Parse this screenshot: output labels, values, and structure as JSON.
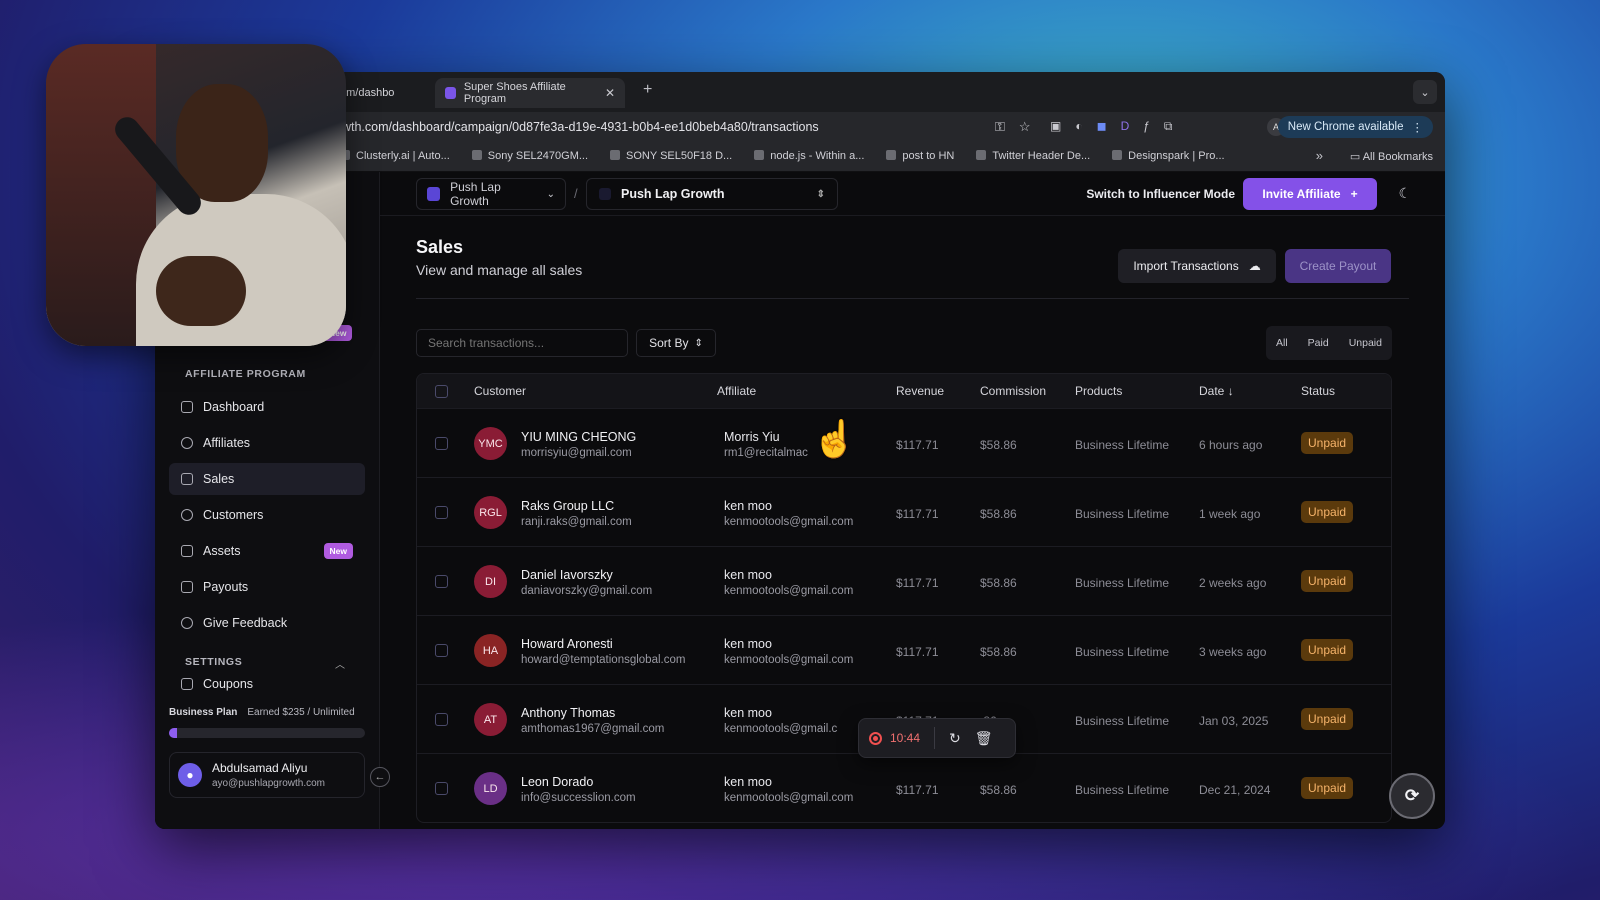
{
  "browser": {
    "tabs": [
      {
        "title": "om/dashbo"
      },
      {
        "title": "Super Shoes Affiliate Program"
      }
    ],
    "url": "owth.com/dashboard/campaign/0d87fe3a-d19e-4931-b0b4-ee1d0beb4a80/transactions",
    "new_chrome_label": "New Chrome available",
    "profile_initial": "A",
    "bookmarks": [
      "Clusterly.ai | Auto...",
      "Sony SEL2470GM...",
      "SONY SEL50F18 D...",
      "node.js - Within a...",
      "post to HN",
      "Twitter Header De...",
      "Designspark | Pro..."
    ],
    "all_bookmarks_label": "All Bookmarks"
  },
  "topbar": {
    "team": "Push Lap Growth",
    "campaign": "Push Lap Growth",
    "switch_mode": "Switch to Influencer Mode",
    "invite_label": "Invite Affiliate"
  },
  "sidebar": {
    "new_badge_top": "New",
    "section_affiliate": "AFFILIATE PROGRAM",
    "items": [
      {
        "label": "Dashboard",
        "active": false,
        "icon": "grid-icon"
      },
      {
        "label": "Affiliates",
        "active": false,
        "icon": "users-icon"
      },
      {
        "label": "Sales",
        "active": true,
        "icon": "receipt-icon"
      },
      {
        "label": "Customers",
        "active": false,
        "icon": "customers-icon"
      },
      {
        "label": "Assets",
        "active": false,
        "icon": "folder-icon",
        "badge": "New"
      },
      {
        "label": "Payouts",
        "active": false,
        "icon": "bank-icon"
      },
      {
        "label": "Give Feedback",
        "active": false,
        "icon": "info-icon"
      }
    ],
    "section_settings": "SETTINGS",
    "settings_partial_item": "Coupons",
    "plan_name": "Business Plan",
    "plan_usage": "Earned $235 / Unlimited",
    "plan_progress": 0.04,
    "user_name": "Abdulsamad Aliyu",
    "user_email": "ayo@pushlapgrowth.com"
  },
  "page": {
    "title": "Sales",
    "subtitle": "View and manage all sales",
    "import_label": "Import Transactions",
    "payout_label": "Create Payout",
    "search_placeholder": "Search transactions...",
    "sort_label": "Sort By",
    "filters": [
      "All",
      "Paid",
      "Unpaid"
    ]
  },
  "table": {
    "headers": {
      "customer": "Customer",
      "affiliate": "Affiliate",
      "revenue": "Revenue",
      "commission": "Commission",
      "products": "Products",
      "date": "Date",
      "status": "Status"
    },
    "rows": [
      {
        "initials": "YMC",
        "color": "#8a1c35",
        "name": "YIU MING CHEONG",
        "email": "morrisyiu@gmail.com",
        "aff_name": "Morris Yiu",
        "aff_email": "rm1@recitalmac",
        "revenue": "$117.71",
        "commission": "$58.86",
        "product": "Business Lifetime",
        "date": "6 hours ago",
        "status": "Unpaid"
      },
      {
        "initials": "RGL",
        "color": "#8a1c35",
        "name": "Raks Group LLC",
        "email": "ranji.raks@gmail.com",
        "aff_name": "ken moo",
        "aff_email": "kenmootools@gmail.com",
        "revenue": "$117.71",
        "commission": "$58.86",
        "product": "Business Lifetime",
        "date": "1 week ago",
        "status": "Unpaid"
      },
      {
        "initials": "DI",
        "color": "#8a1c35",
        "name": "Daniel Iavorszky",
        "email": "daniavorszky@gmail.com",
        "aff_name": "ken moo",
        "aff_email": "kenmootools@gmail.com",
        "revenue": "$117.71",
        "commission": "$58.86",
        "product": "Business Lifetime",
        "date": "2 weeks ago",
        "status": "Unpaid"
      },
      {
        "initials": "HA",
        "color": "#8a2424",
        "name": "Howard Aronesti",
        "email": "howard@temptationsglobal.com",
        "aff_name": "ken moo",
        "aff_email": "kenmootools@gmail.com",
        "revenue": "$117.71",
        "commission": "$58.86",
        "product": "Business Lifetime",
        "date": "3 weeks ago",
        "status": "Unpaid"
      },
      {
        "initials": "AT",
        "color": "#8a1c35",
        "name": "Anthony Thomas",
        "email": "amthomas1967@gmail.com",
        "aff_name": "ken moo",
        "aff_email": "kenmootools@gmail.c",
        "revenue": "$117.71",
        "commission": ".86",
        "product": "Business Lifetime",
        "date": "Jan 03, 2025",
        "status": "Unpaid"
      },
      {
        "initials": "LD",
        "color": "#6a2f86",
        "name": "Leon Dorado",
        "email": "info@successlion.com",
        "aff_name": "ken moo",
        "aff_email": "kenmootools@gmail.com",
        "revenue": "$117.71",
        "commission": "$58.86",
        "product": "Business Lifetime",
        "date": "Dec 21, 2024",
        "status": "Unpaid"
      }
    ]
  },
  "recorder": {
    "time": "10:44"
  },
  "colors": {
    "accent": "#8451e8",
    "unpaid_bg": "#5b3a0c",
    "unpaid_text": "#f6b36a"
  }
}
